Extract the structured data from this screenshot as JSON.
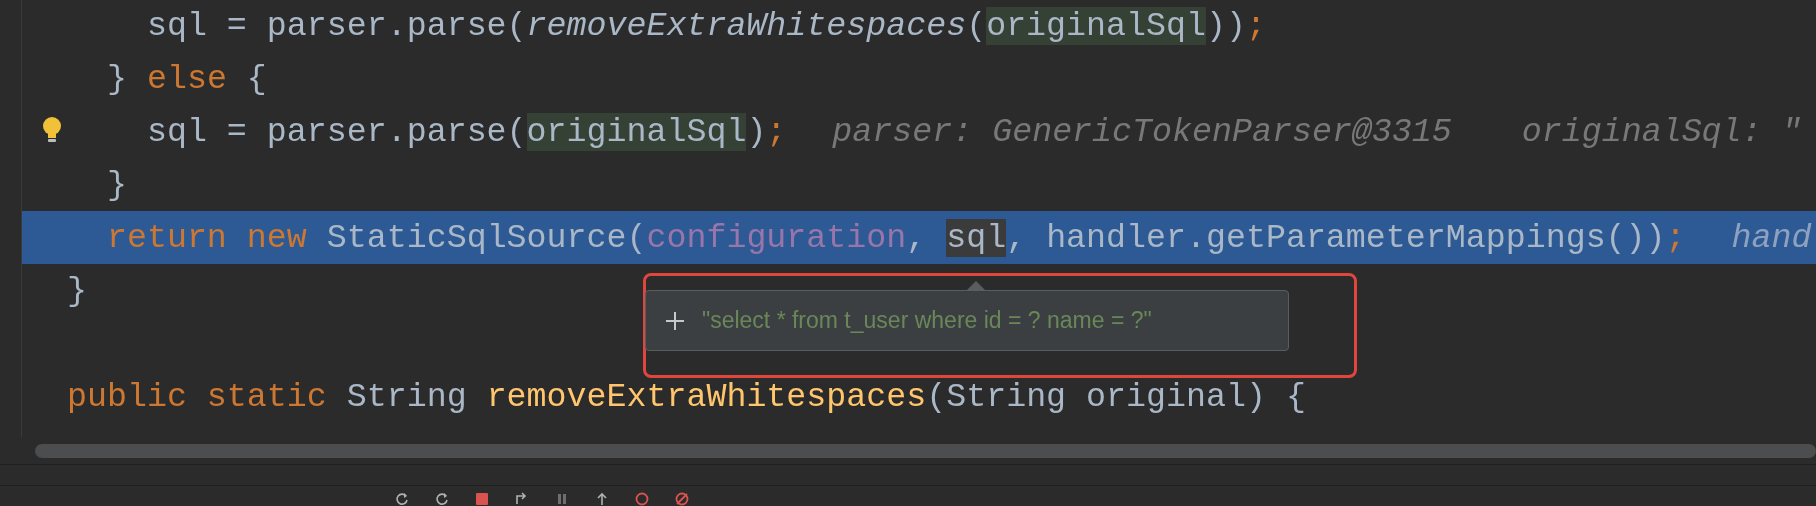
{
  "editor": {
    "lines": [
      {
        "highlighted": false,
        "bulb": false,
        "tokens": [
          {
            "kind": "plain",
            "text": "    sql = parser.parse("
          },
          {
            "kind": "static_call",
            "text": "removeExtraWhitespaces"
          },
          {
            "kind": "plain",
            "text": "("
          },
          {
            "kind": "usage",
            "text": "originalSql"
          },
          {
            "kind": "plain",
            "text": "))"
          },
          {
            "kind": "keyword",
            "text": ";"
          }
        ]
      },
      {
        "highlighted": false,
        "bulb": false,
        "tokens": [
          {
            "kind": "plain",
            "text": "  } "
          },
          {
            "kind": "keyword",
            "text": "else"
          },
          {
            "kind": "plain",
            "text": " {"
          }
        ]
      },
      {
        "highlighted": false,
        "bulb": true,
        "tokens": [
          {
            "kind": "plain",
            "text": "    sql = parser.parse("
          },
          {
            "kind": "usage",
            "text": "originalSql"
          },
          {
            "kind": "plain",
            "text": ")"
          },
          {
            "kind": "keyword",
            "text": ";"
          }
        ],
        "hints": [
          "parser: GenericTokenParser@3315",
          "originalSql: \""
        ]
      },
      {
        "highlighted": false,
        "bulb": false,
        "tokens": [
          {
            "kind": "plain",
            "text": "  }"
          }
        ]
      },
      {
        "highlighted": true,
        "bulb": false,
        "tokens": [
          {
            "kind": "keyword",
            "text": "  return"
          },
          {
            "kind": "keyword",
            "text": " new"
          },
          {
            "kind": "plain",
            "text": " StaticSqlSource("
          },
          {
            "kind": "field",
            "text": "configuration"
          },
          {
            "kind": "plain",
            "text": ", "
          },
          {
            "kind": "caret_word",
            "text": "sql"
          },
          {
            "kind": "plain",
            "text": ", handler.getParameterMappings())"
          },
          {
            "kind": "keyword",
            "text": ";"
          }
        ],
        "hints": [
          "hand"
        ]
      },
      {
        "highlighted": false,
        "bulb": false,
        "tokens": [
          {
            "kind": "plain",
            "text": "}"
          }
        ]
      },
      {
        "highlighted": false,
        "bulb": false
      },
      {
        "highlighted": false,
        "bulb": false,
        "tokens": [
          {
            "kind": "keyword",
            "text": "public"
          },
          {
            "kind": "keyword",
            "text": " static"
          },
          {
            "kind": "plain",
            "text": " String "
          },
          {
            "kind": "method",
            "text": "removeExtraWhitespaces"
          },
          {
            "kind": "plain",
            "text": "(String original) {"
          }
        ]
      }
    ]
  },
  "value_popup": {
    "value": "\"select * from t_user where id = ? name = ?\""
  }
}
